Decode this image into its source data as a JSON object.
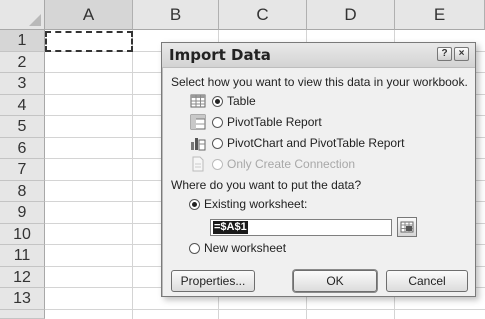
{
  "sheet": {
    "columns": [
      "A",
      "B",
      "C",
      "D",
      "E"
    ],
    "rows": [
      "1",
      "2",
      "3",
      "4",
      "5",
      "6",
      "7",
      "8",
      "9",
      "10",
      "11",
      "12",
      "13"
    ],
    "active_cell": "A1"
  },
  "dialog": {
    "title": "Import Data",
    "help_button": "?",
    "close_button": "×",
    "view_prompt": "Select how you want to view this data in your workbook.",
    "view_options": [
      {
        "label": "Table",
        "selected": true,
        "enabled": true,
        "icon": "table-icon"
      },
      {
        "label": "PivotTable Report",
        "selected": false,
        "enabled": true,
        "icon": "pivottable-icon"
      },
      {
        "label": "PivotChart and PivotTable Report",
        "selected": false,
        "enabled": true,
        "icon": "pivotchart-icon"
      },
      {
        "label": "Only Create Connection",
        "selected": false,
        "enabled": false,
        "icon": "connection-icon"
      }
    ],
    "location_prompt": "Where do you want to put the data?",
    "location_options": [
      {
        "label": "Existing worksheet:",
        "selected": true
      },
      {
        "label": "New worksheet",
        "selected": false
      }
    ],
    "reference_value": "=$A$1",
    "buttons": {
      "properties": "Properties...",
      "ok": "OK",
      "cancel": "Cancel"
    }
  }
}
